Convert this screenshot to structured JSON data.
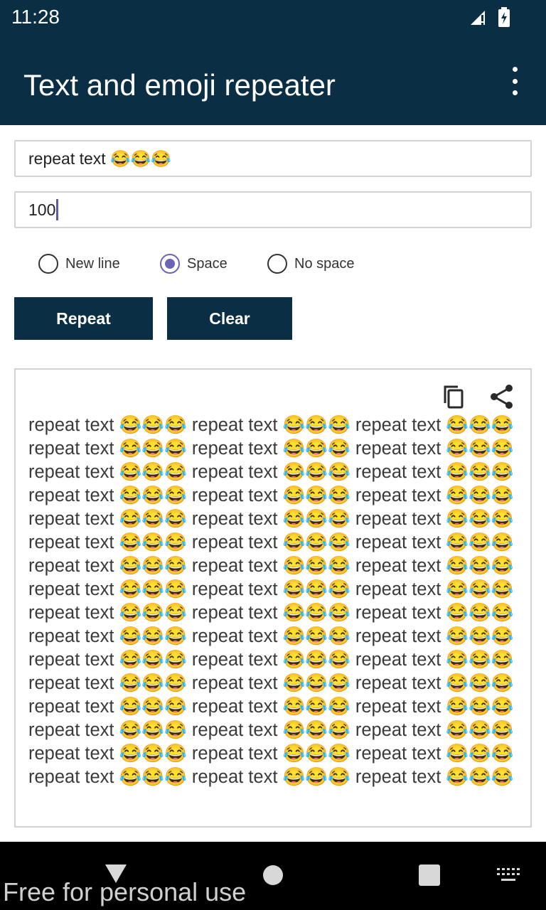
{
  "status_bar": {
    "time": "11:28",
    "icons": [
      "signal-icon",
      "battery-charging-icon"
    ]
  },
  "app_bar": {
    "title": "Text and emoji repeater",
    "menu_icon": "more-vert-icon"
  },
  "form": {
    "text_input_value": "repeat text 😂😂😂",
    "count_input_value": "100"
  },
  "separator_options": {
    "new_line_label": "New line",
    "space_label": "Space",
    "no_space_label": "No space",
    "selected": "Space"
  },
  "buttons": {
    "repeat_label": "Repeat",
    "clear_label": "Clear"
  },
  "output": {
    "copy_icon": "copy-icon",
    "share_icon": "share-icon",
    "text": " repeat text 😂😂😂 repeat text 😂😂😂 repeat text 😂😂😂 repeat text 😂😂😂 repeat text 😂😂😂 repeat text 😂😂😂 repeat text 😂😂😂 repeat text 😂😂😂 repeat text 😂😂😂 repeat text 😂😂😂 repeat text 😂😂😂 repeat text 😂😂😂 repeat text 😂😂😂 repeat text 😂😂😂 repeat text 😂😂😂 repeat text 😂😂😂 repeat text 😂😂😂 repeat text 😂😂😂 repeat text 😂😂😂 repeat text 😂😂😂 repeat text 😂😂😂 repeat text 😂😂😂 repeat text 😂😂😂 repeat text 😂😂😂 repeat text 😂😂😂 repeat text 😂😂😂 repeat text 😂😂😂 repeat text 😂😂😂 repeat text 😂😂😂 repeat text 😂😂😂 repeat text 😂😂😂 repeat text 😂😂😂 repeat text 😂😂😂 repeat text 😂😂😂 repeat text 😂😂😂 repeat text 😂😂😂 repeat text 😂😂😂 repeat text 😂😂😂 repeat text 😂😂😂 repeat text 😂😂😂 repeat text 😂😂😂 repeat text 😂😂😂 repeat text 😂😂😂 repeat text 😂😂😂 repeat text 😂😂😂 repeat text 😂😂😂 repeat text 😂😂😂 repeat text 😂😂😂"
  },
  "nav_bar": {
    "icons": [
      "back-icon",
      "home-icon",
      "recents-icon",
      "keyboard-icon"
    ]
  },
  "watermark": "Free for personal use",
  "colors": {
    "primary": "#0a2e43",
    "radio_accent": "#6b63b8"
  }
}
